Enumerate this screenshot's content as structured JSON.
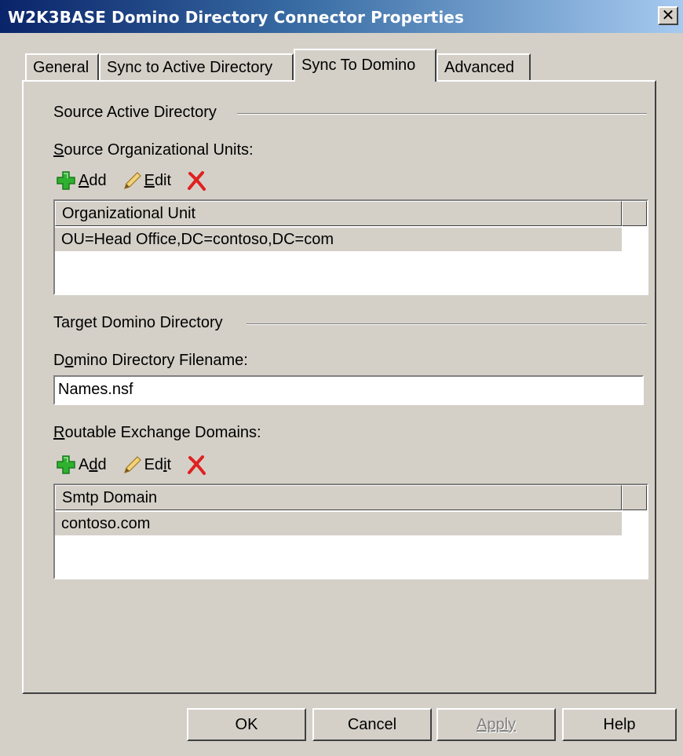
{
  "window": {
    "title": "W2K3BASE Domino Directory Connector Properties",
    "close_label": "✕"
  },
  "tabs": [
    {
      "label": "General",
      "active": false
    },
    {
      "label": "Sync to Active Directory",
      "active": false
    },
    {
      "label": "Sync To Domino",
      "active": true
    },
    {
      "label": "Advanced",
      "active": false
    }
  ],
  "source_group": {
    "title": "Source Active Directory",
    "ou_label_first": "S",
    "ou_label_rest": "ource Organizational Units:",
    "toolbar": {
      "add_first": "A",
      "add_rest": "dd",
      "edit_first": "E",
      "edit_rest": "dit"
    },
    "list": {
      "column": "Organizational Unit",
      "rows": [
        "OU=Head Office,DC=contoso,DC=com"
      ]
    }
  },
  "target_group": {
    "title": "Target Domino Directory",
    "filename_label_pre": "D",
    "filename_label_u": "o",
    "filename_label_rest": "mino Directory Filename:",
    "filename_value": "Names.nsf",
    "domains_label_first": "R",
    "domains_label_rest": "outable Exchange Domains:",
    "toolbar": {
      "add_pre": "A",
      "add_u": "d",
      "add_rest": "d",
      "edit_pre": "Ed",
      "edit_u": "i",
      "edit_rest": "t"
    },
    "list": {
      "column": "Smtp Domain",
      "rows": [
        "contoso.com"
      ]
    }
  },
  "buttons": {
    "ok": "OK",
    "cancel": "Cancel",
    "apply": "Apply",
    "help": "Help"
  },
  "colors": {
    "title_gradient_start": "#0a246a",
    "title_gradient_end": "#a6caf0",
    "face": "#d4d0c8",
    "add_icon": "#2fb12f",
    "delete_icon": "#e02020"
  }
}
